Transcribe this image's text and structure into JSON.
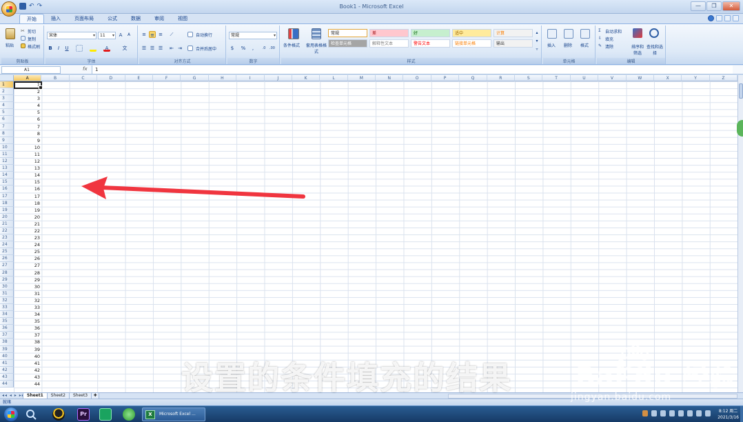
{
  "window": {
    "title": "Book1 - Microsoft Excel",
    "controls": [
      "—",
      "❐",
      "✕"
    ]
  },
  "ribbon_tabs": [
    "开始",
    "插入",
    "页面布局",
    "公式",
    "数据",
    "审阅",
    "视图"
  ],
  "ribbon": {
    "clipboard": {
      "label": "剪贴板",
      "paste": "粘贴",
      "cut": "剪切",
      "copy": "复制",
      "format_painter": "格式刷"
    },
    "font": {
      "label": "字体",
      "font_name": "宋体",
      "font_size": "11"
    },
    "alignment": {
      "label": "对齐方式",
      "wrap_text": "自动换行",
      "merge_center": "合并后居中"
    },
    "number": {
      "label": "数字",
      "format": "常规"
    },
    "styles": {
      "label": "样式",
      "conditional_formatting": "条件格式",
      "format_as_table": "套用表格格式",
      "cells": [
        {
          "name": "常规",
          "bg": "#ffffff",
          "fg": "#222222"
        },
        {
          "name": "差",
          "bg": "#ffc7ce",
          "fg": "#9c0006"
        },
        {
          "name": "好",
          "bg": "#c6efce",
          "fg": "#006100"
        },
        {
          "name": "适中",
          "bg": "#ffeb9c",
          "fg": "#9c6500"
        },
        {
          "name": "计算",
          "bg": "#f2f2f2",
          "fg": "#fa7d00"
        },
        {
          "name": "检查单元格",
          "bg": "#a5a5a5",
          "fg": "#ffffff"
        },
        {
          "name": "解释性文本",
          "bg": "#ffffff",
          "fg": "#7f7f7f"
        },
        {
          "name": "警告文本",
          "bg": "#ffffff",
          "fg": "#ff0000"
        },
        {
          "name": "链接单元格",
          "bg": "#ffffff",
          "fg": "#fa7d00"
        },
        {
          "name": "输出",
          "bg": "#f2f2f2",
          "fg": "#3f3f3f"
        }
      ]
    },
    "cells_group": {
      "label": "单元格",
      "insert": "插入",
      "delete": "删除",
      "format": "格式"
    },
    "editing": {
      "label": "编辑",
      "autosum": "自动求和",
      "fill": "填充",
      "clear": "清除",
      "sort_filter": "排序和筛选",
      "find_select": "查找和选择"
    }
  },
  "formula_bar": {
    "name_box": "A1",
    "fx": "fx",
    "value": "1"
  },
  "columns": [
    "A",
    "B",
    "C",
    "D",
    "E",
    "F",
    "G",
    "H",
    "I",
    "J",
    "K",
    "L",
    "M",
    "N",
    "O",
    "P",
    "Q",
    "R",
    "S",
    "T",
    "U",
    "V",
    "W",
    "X",
    "Y",
    "Z"
  ],
  "rows": [
    "1",
    "2",
    "3",
    "4",
    "5",
    "6",
    "7",
    "8",
    "9",
    "10",
    "11",
    "12",
    "13",
    "14",
    "15",
    "16",
    "17",
    "18",
    "19",
    "20",
    "21",
    "22",
    "23",
    "24",
    "25",
    "26",
    "27",
    "28",
    "29",
    "30",
    "31",
    "32",
    "33",
    "34",
    "35",
    "36",
    "37",
    "38",
    "39",
    "40",
    "41",
    "42",
    "43",
    "44"
  ],
  "column_a_values": [
    "1",
    "2",
    "3",
    "4",
    "5",
    "6",
    "7",
    "8",
    "9",
    "10",
    "11",
    "12",
    "13",
    "14",
    "15",
    "16",
    "17",
    "18",
    "19",
    "20",
    "21",
    "22",
    "23",
    "24",
    "25",
    "26",
    "27",
    "28",
    "29",
    "30",
    "31",
    "32",
    "33",
    "34",
    "35",
    "36",
    "37",
    "38",
    "39",
    "40",
    "41",
    "42",
    "43",
    "44"
  ],
  "sheet_tabs": [
    "Sheet1",
    "Sheet2",
    "Sheet3"
  ],
  "sheet_nav": "◂◂ ◂ ▸ ▸▸",
  "status": "就绪",
  "taskbar": {
    "excel_label": "Microsoft Excel ...",
    "excel_icon_text": "X",
    "clock_time": "8:12 周二",
    "clock_date": "2021/3/16"
  },
  "overlay": {
    "caption": "设置的条件填充的结果",
    "watermark_brand": "Bai du 经验",
    "watermark_url": "jingyan.baidu.com"
  },
  "colors": {
    "arrow": "#f0353f",
    "accent": "#15428b",
    "selection_header": "#f6c85f"
  }
}
